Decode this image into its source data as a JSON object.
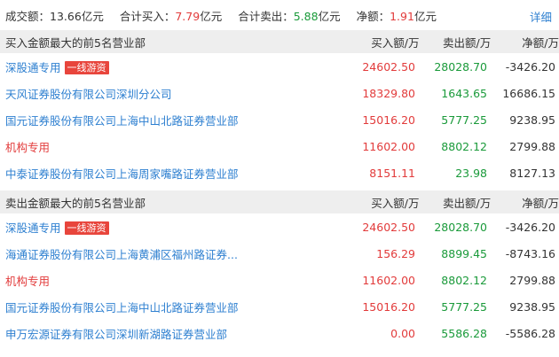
{
  "summary": {
    "volume_label": "成交额：",
    "volume_value": "13.66",
    "volume_unit": "亿元",
    "buy_label": "合计买入：",
    "buy_value": "7.79",
    "buy_unit": "亿元",
    "sell_label": "合计卖出：",
    "sell_value": "5.88",
    "sell_unit": "亿元",
    "net_label": "净额：",
    "net_value": "1.91",
    "net_unit": "亿元",
    "detail_link": "详细"
  },
  "buy_section": {
    "title": "买入金额最大的前5名营业部",
    "col_buy": "买入额/万",
    "col_sell": "卖出额/万",
    "col_net": "净额/万",
    "rows": [
      {
        "name": "深股通专用",
        "tag": "一线游资",
        "buy": "24602.50",
        "sell": "28028.70",
        "net": "-3426.20"
      },
      {
        "name": "天风证券股份有限公司深圳分公司",
        "tag": "",
        "buy": "18329.80",
        "sell": "1643.65",
        "net": "16686.15"
      },
      {
        "name": "国元证券股份有限公司上海中山北路证券营业部",
        "tag": "",
        "buy": "15016.20",
        "sell": "5777.25",
        "net": "9238.95"
      },
      {
        "name": "机构专用",
        "tag": "",
        "buy": "11602.00",
        "sell": "8802.12",
        "net": "2799.88"
      },
      {
        "name": "中泰证券股份有限公司上海周家嘴路证券营业部",
        "tag": "",
        "buy": "8151.11",
        "sell": "23.98",
        "net": "8127.13"
      }
    ]
  },
  "sell_section": {
    "title": "卖出金额最大的前5名营业部",
    "col_buy": "买入额/万",
    "col_sell": "卖出额/万",
    "col_net": "净额/万",
    "rows": [
      {
        "name": "深股通专用",
        "tag": "一线游资",
        "buy": "24602.50",
        "sell": "28028.70",
        "net": "-3426.20"
      },
      {
        "name": "海通证券股份有限公司上海黄浦区福州路证券...",
        "tag": "",
        "buy": "156.29",
        "sell": "8899.45",
        "net": "-8743.16"
      },
      {
        "name": "机构专用",
        "tag": "",
        "buy": "11602.00",
        "sell": "8802.12",
        "net": "2799.88"
      },
      {
        "name": "国元证券股份有限公司上海中山北路证券营业部",
        "tag": "",
        "buy": "15016.20",
        "sell": "5777.25",
        "net": "9238.95"
      },
      {
        "name": "申万宏源证券有限公司深圳新湖路证券营业部",
        "tag": "",
        "buy": "0.00",
        "sell": "5586.28",
        "net": "-5586.28"
      }
    ]
  },
  "colors": {
    "link": "#2d7fd0",
    "institution": "#e23b3b",
    "buy": "#e23b3b",
    "sell": "#1a9a3a",
    "tag_bg": "#e8453c",
    "header_bg": "#eeeeee"
  }
}
